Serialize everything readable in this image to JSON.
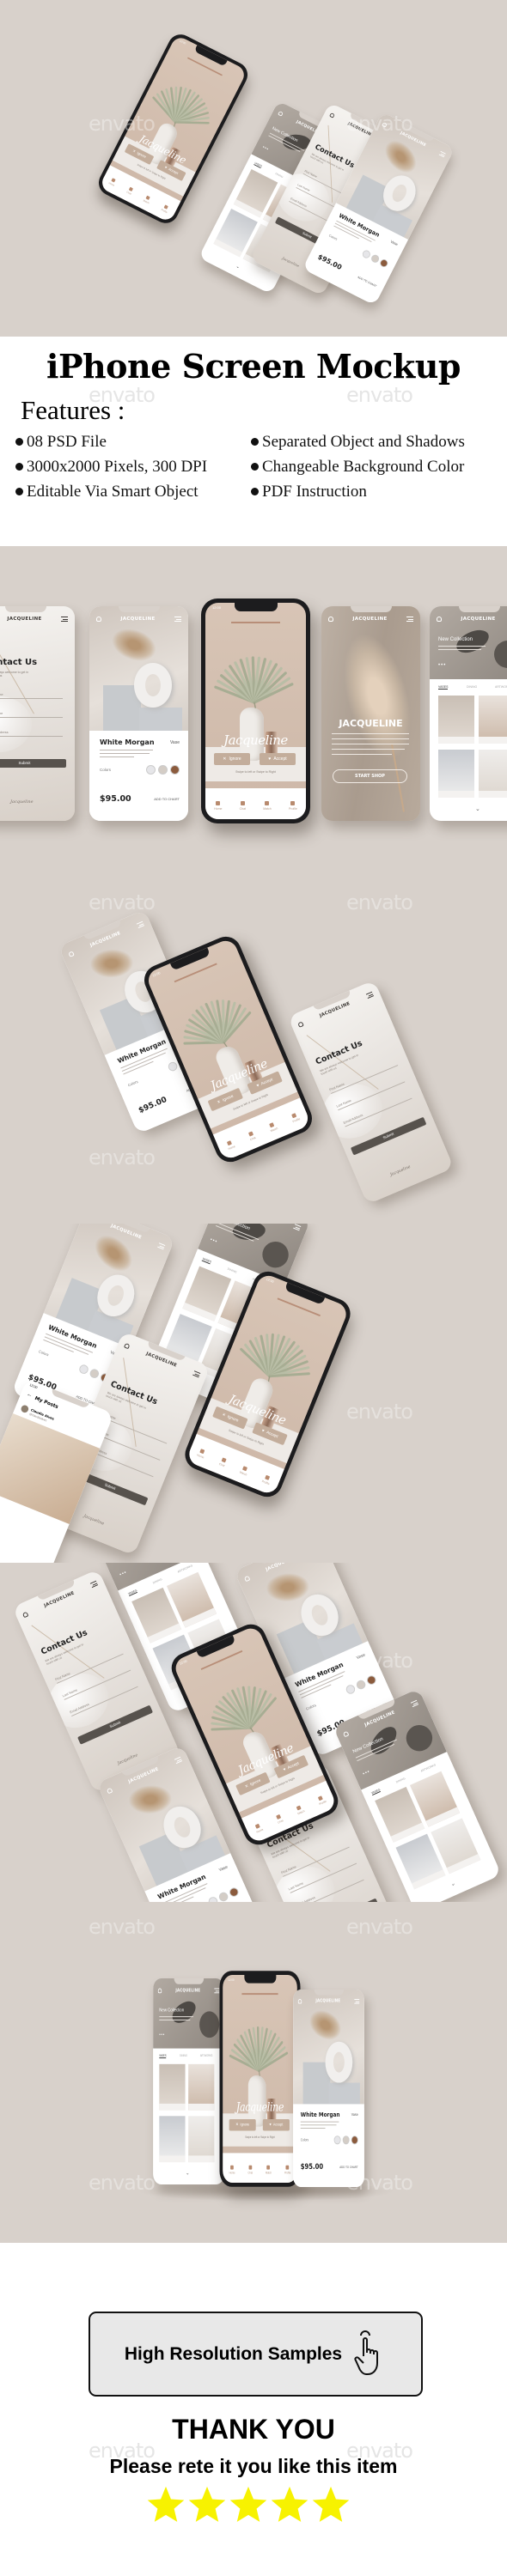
{
  "watermark": "envato",
  "colors": {
    "background": "#d8d1cb",
    "accent": "#c3ad9b",
    "submit": "#57524d",
    "star": "#f7f200"
  },
  "features": {
    "title": "iPhone Screen Mockup",
    "heading": "Features :",
    "items_left": [
      "08 PSD File",
      "3000x2000 Pixels, 300 DPI",
      "Editable Via Smart Object"
    ],
    "items_right": [
      "Separated Object and Shadows",
      "Changeable Background Color",
      "PDF Instruction"
    ]
  },
  "screens": {
    "brand": "JACQUELINE",
    "home": {
      "time": "12:00",
      "logo": "Jacqueline",
      "ignore": "Ignore",
      "accept": "Accept",
      "swipe_hint": "Swipe to left or Swipe to Right",
      "nav": [
        "Home",
        "Chat",
        "Match",
        "Profile"
      ]
    },
    "detail": {
      "title": "White Morgan",
      "category": "Vase",
      "colors_label": "Colors",
      "swatches": [
        "#e6e6e9",
        "#d4cdc6",
        "#8b5b3d"
      ],
      "price": "$95.00",
      "cta": "ADD TO CHART"
    },
    "contact": {
      "title": "Contact Us",
      "subtitle": "We are always welcome to get in touch with us",
      "fields": [
        "First Name",
        "Last Name",
        "Email Address"
      ],
      "submit": "Submit",
      "signature": "Jacqueline"
    },
    "splash": {
      "title": "JACQUELINE",
      "cta": "START SHOP"
    },
    "shop": {
      "title": "New Collection",
      "tabs": [
        "VASES",
        "DINING",
        "ARTWORKS"
      ]
    },
    "posts": {
      "time": "12:00",
      "title": "My Posts",
      "user": "Claudia Alves",
      "handle": "@claudiaalves"
    }
  },
  "footer": {
    "button": "High Resolution Samples",
    "thanks": "THANK YOU",
    "rate_prompt": "Please rete it you like this item",
    "rating": 5
  }
}
